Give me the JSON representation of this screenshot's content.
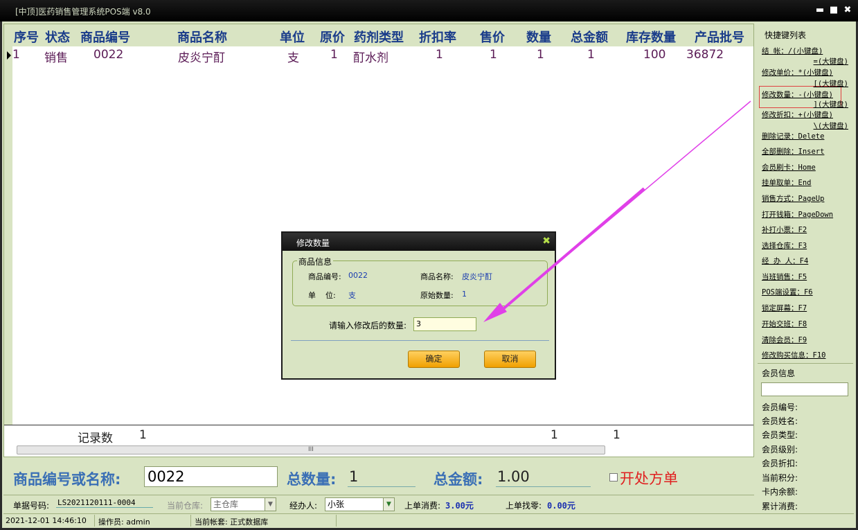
{
  "window": {
    "title": "[中顶]医药销售管理系统POS端 v8.0",
    "min": "▬",
    "max": "■",
    "close": "✖"
  },
  "grid": {
    "columns": [
      "序号",
      "状态",
      "商品编号",
      "商品名称",
      "单位",
      "原价",
      "药剂类型",
      "折扣率",
      "售价",
      "数量",
      "总金额",
      "库存数量",
      "产品批号"
    ],
    "rows": [
      [
        "1",
        "销售",
        "0022",
        "皮炎宁酊",
        "支",
        "1",
        "酊水剂",
        "1",
        "1",
        "1",
        "1",
        "100",
        "36872"
      ]
    ],
    "footer": {
      "label": "记录数",
      "count": "1",
      "qty_total": "1",
      "amount_total": "1"
    },
    "scroll_grip": "III"
  },
  "sidebar": {
    "title": "快捷键列表",
    "items": [
      {
        "label": "结    帐：/(小键盘)",
        "sub": "=(大键盘)"
      },
      {
        "label": "修改单价：*(小键盘)",
        "sub": "[(大键盘)"
      },
      {
        "label": "修改数量：-(小键盘)",
        "sub": "](大键盘)"
      },
      {
        "label": "修改折扣：+(小键盘)",
        "sub": "\\(大键盘)"
      },
      {
        "label": "删除记录：Delete"
      },
      {
        "label": "全部删除：Insert"
      },
      {
        "label": "会员刷卡：Home"
      },
      {
        "label": "挂单取单：End"
      },
      {
        "label": "销售方式：PageUp"
      },
      {
        "label": "打开钱箱：PageDown"
      },
      {
        "label": "补打小票：F2"
      },
      {
        "label": "选择仓库：F3"
      },
      {
        "label": "经 办 人：F4"
      },
      {
        "label": "当班销售：F5"
      },
      {
        "label": "POS端设置：F6"
      },
      {
        "label": "锁定屏幕：F7"
      },
      {
        "label": "开始交班：F8"
      },
      {
        "label": "清除会员：F9"
      },
      {
        "label": "修改购买信息：F10"
      }
    ],
    "member": {
      "title": "会员信息",
      "fields": [
        "会员编号:",
        "会员姓名:",
        "会员类型:",
        "会员级别:",
        "会员折扣:",
        "当前积分:",
        "卡内余额:",
        "累计消费:"
      ]
    }
  },
  "entry": {
    "code_label": "商品编号或名称:",
    "code_value": "0022",
    "qty_label": "总数量:",
    "qty_value": "1",
    "amount_label": "总金额:",
    "amount_value": "1.00",
    "prescription_label": "开处方单"
  },
  "info": {
    "bill_label": "单据号码:",
    "bill_no": "LS2021120111-0004",
    "warehouse_label": "当前仓库:",
    "warehouse_value": "主仓库",
    "handler_label": "经办人:",
    "handler_value": "小张",
    "last_spend_label": "上单消费:",
    "last_spend_value": "3.00元",
    "last_change_label": "上单找零:",
    "last_change_value": "0.00元"
  },
  "status": {
    "datetime": "2021-12-01 14:46:10",
    "operator": "操作员: admin",
    "account": "当前帐套: 正式数据库"
  },
  "dialog": {
    "title": "修改数量",
    "close": "✖",
    "group_title": "商品信息",
    "code_label": "商品编号:",
    "code_value": "0022",
    "name_label": "商品名称:",
    "name_value": "皮炎宁酊",
    "unit_label": "单    位:",
    "unit_value": "支",
    "orig_qty_label": "原始数量:",
    "orig_qty_value": "1",
    "prompt": "请输入修改后的数量:",
    "input_value": "3",
    "ok": "确定",
    "cancel": "取消"
  }
}
